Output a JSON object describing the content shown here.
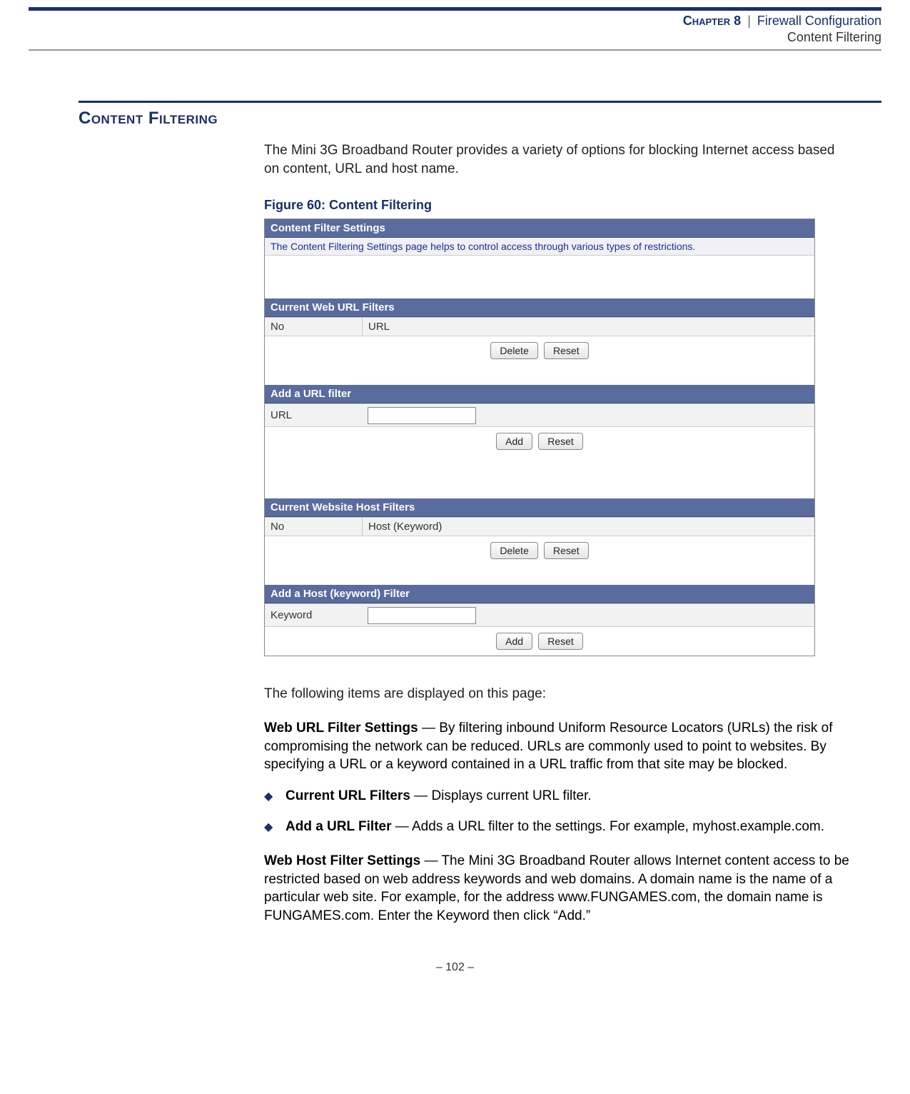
{
  "header": {
    "chapter": "Chapter 8",
    "title": "Firewall Configuration",
    "subtitle": "Content Filtering"
  },
  "section": {
    "heading": "Content Filtering",
    "intro": "The Mini 3G Broadband Router provides a variety of options for blocking Internet access based on content, URL and host name.",
    "figure_caption": "Figure 60:  Content Filtering"
  },
  "screenshot": {
    "title_bar": "Content Filter Settings",
    "helper": "The Content Filtering Settings page helps to control access through various types of restrictions.",
    "url_filters_bar": "Current Web URL Filters",
    "col_no": "No",
    "col_url": "URL",
    "btn_delete": "Delete",
    "btn_reset": "Reset",
    "add_url_bar": "Add a URL filter",
    "label_url": "URL",
    "btn_add": "Add",
    "host_filters_bar": "Current Website Host Filters",
    "col_host": "Host (Keyword)",
    "add_host_bar": "Add a Host (keyword) Filter",
    "label_keyword": "Keyword"
  },
  "description": {
    "lead": "The following items are displayed on this page:",
    "p1_bold": "Web URL Filter Settings",
    "p1_rest": " — By filtering inbound Uniform Resource Locators (URLs) the risk of compromising the network can be reduced. URLs are commonly used to point to websites. By specifying a URL or a keyword contained in a URL traffic from that site may be blocked.",
    "b1_bold": "Current URL Filters",
    "b1_rest": " — Displays current URL filter.",
    "b2_bold": "Add a URL Filter",
    "b2_rest": " — Adds a URL filter to the settings. For example, myhost.example.com.",
    "p2_bold": "Web Host Filter Settings",
    "p2_rest": " — The Mini 3G Broadband Router allows Internet content access to be restricted based on web address keywords and web domains. A domain name is the name of a particular web site. For example, for the address www.FUNGAMES.com, the domain name is FUNGAMES.com. Enter the Keyword then click “Add.”"
  },
  "footer": {
    "page": "–  102  –"
  }
}
